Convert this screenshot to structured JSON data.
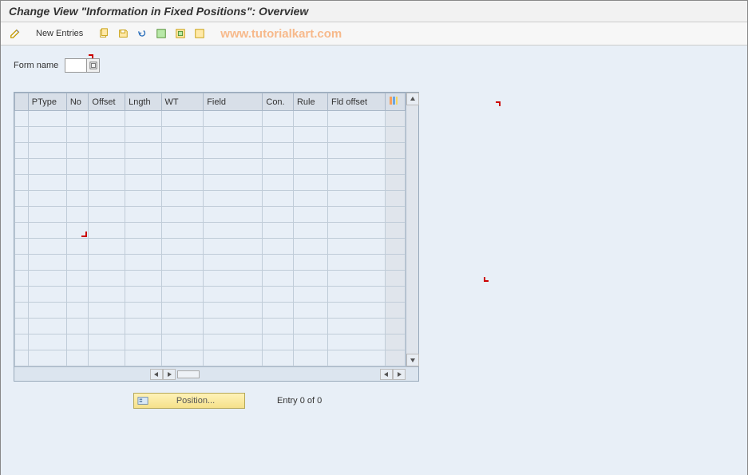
{
  "title": "Change View \"Information in Fixed Positions\": Overview",
  "toolbar": {
    "new_entries_label": "New Entries"
  },
  "watermark": "www.tutorialkart.com",
  "form": {
    "name_label": "Form name",
    "name_value": ""
  },
  "table": {
    "columns": {
      "ptype": "PType",
      "no": "No",
      "offset": "Offset",
      "lngth": "Lngth",
      "wt": "WT",
      "field": "Field",
      "con": "Con.",
      "rule": "Rule",
      "fld_offset": "Fld offset"
    },
    "row_count": 16
  },
  "footer": {
    "position_label": "Position...",
    "entry_status": "Entry 0 of 0"
  }
}
